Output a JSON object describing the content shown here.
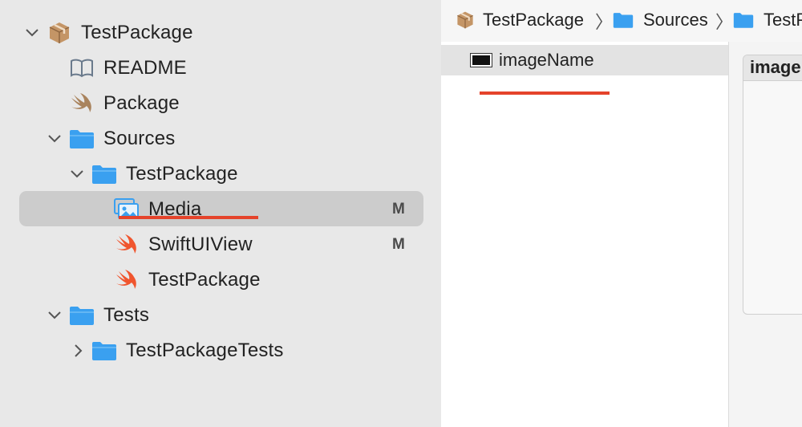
{
  "navigator": {
    "items": [
      {
        "label": "TestPackage",
        "icon": "package-icon",
        "expanded": true
      },
      {
        "label": "README",
        "icon": "book-icon"
      },
      {
        "label": "Package",
        "icon": "swift-icon"
      },
      {
        "label": "Sources",
        "icon": "folder-icon",
        "expanded": true
      },
      {
        "label": "TestPackage",
        "icon": "folder-icon",
        "expanded": true
      },
      {
        "label": "Media",
        "icon": "asset-catalog-icon",
        "badge": "M",
        "selected": true
      },
      {
        "label": "SwiftUIView",
        "icon": "swift-icon",
        "badge": "M"
      },
      {
        "label": "TestPackage",
        "icon": "swift-icon"
      },
      {
        "label": "Tests",
        "icon": "folder-icon",
        "expanded": true
      },
      {
        "label": "TestPackageTests",
        "icon": "folder-icon",
        "expanded": false
      }
    ]
  },
  "breadcrumb": [
    "TestPackage",
    "Sources",
    "TestP"
  ],
  "asset_list": {
    "item": "imageName"
  },
  "detail": {
    "title": "image"
  },
  "colors": {
    "sidebar_bg": "#e8e8e8",
    "selection": "#cccccc",
    "folder": "#3aa0f0",
    "swift": "#f0552e",
    "package": "#b8875a",
    "annotation": "#e5432b"
  }
}
